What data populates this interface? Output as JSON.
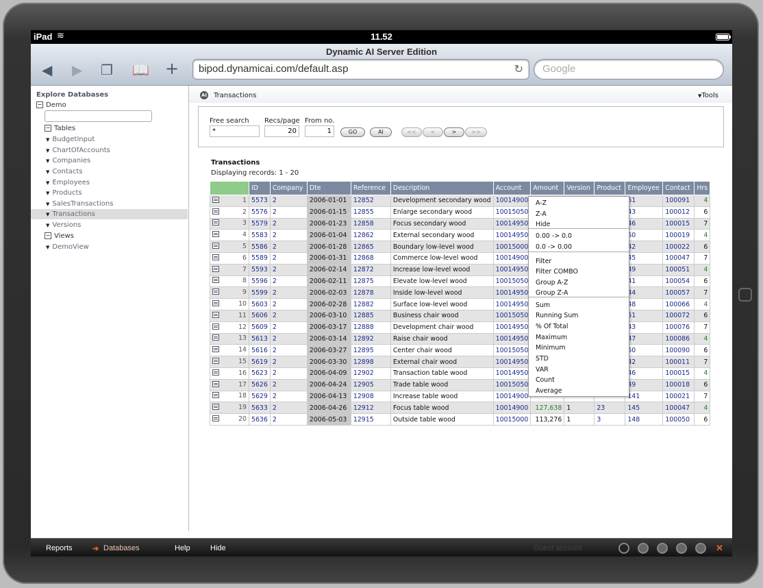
{
  "status": {
    "carrier": "iPad",
    "time": "11.52"
  },
  "browser": {
    "title": "Dynamic AI Server Edition",
    "url": "bipod.dynamicai.com/default.asp",
    "search_placeholder": "Google"
  },
  "sidebar": {
    "header": "Explore Databases",
    "root": "Demo",
    "tables_label": "Tables",
    "tables": [
      "BudgetInput",
      "ChartOfAccounts",
      "Companies",
      "Contacts",
      "Employees",
      "Products",
      "SalesTransactions",
      "Transactions",
      "Versions"
    ],
    "views_label": "Views",
    "views": [
      "DemoView"
    ]
  },
  "main": {
    "title": "Transactions",
    "tools": "Tools",
    "search": {
      "free_label": "Free search",
      "free_value": "*",
      "recs_label": "Recs/page",
      "recs_value": "20",
      "from_label": "From no.",
      "from_value": "1",
      "go": "GO",
      "ai": "AI",
      "first": "<<",
      "prev": "<",
      "next": ">",
      "last": ">>"
    },
    "table_title": "Transactions",
    "displaying": "Displaying records: 1 - 20"
  },
  "grid": {
    "columns": [
      "",
      "ID",
      "Company",
      "Dte",
      "Reference",
      "Description",
      "Account",
      "Amount",
      "Version",
      "Product",
      "Employee",
      "Contact",
      "Hrs"
    ],
    "rows": [
      [
        "1",
        "5573",
        "2",
        "2006-01-01",
        "12852",
        "Development secondary wood",
        "10014900",
        "",
        "",
        "",
        "51",
        "100091",
        "4"
      ],
      [
        "2",
        "5576",
        "2",
        "2006-01-15",
        "12855",
        "Enlarge secondary wood",
        "10015050",
        "",
        "",
        "",
        "43",
        "100012",
        "6"
      ],
      [
        "3",
        "5579",
        "2",
        "2006-01-23",
        "12858",
        "Focus secondary wood",
        "10014950",
        "",
        "",
        "",
        "46",
        "100015",
        "7"
      ],
      [
        "4",
        "5583",
        "2",
        "2006-01-04",
        "12862",
        "External secondary wood",
        "10014950",
        "",
        "",
        "",
        "50",
        "100019",
        "4"
      ],
      [
        "5",
        "5586",
        "2",
        "2006-01-28",
        "12865",
        "Boundary low-level wood",
        "10015000",
        "",
        "",
        "",
        "42",
        "100022",
        "6"
      ],
      [
        "6",
        "5589",
        "2",
        "2006-01-31",
        "12868",
        "Commerce low-level wood",
        "10014900",
        "",
        "",
        "",
        "45",
        "100047",
        "7"
      ],
      [
        "7",
        "5593",
        "2",
        "2006-02-14",
        "12872",
        "Increase low-level wood",
        "10014950",
        "",
        "",
        "",
        "49",
        "100051",
        "4"
      ],
      [
        "8",
        "5596",
        "2",
        "2006-02-11",
        "12875",
        "Elevate low-level wood",
        "10015050",
        "",
        "",
        "",
        "41",
        "100054",
        "6"
      ],
      [
        "9",
        "5599",
        "2",
        "2006-02-03",
        "12878",
        "Inside low-level wood",
        "10014950",
        "",
        "",
        "",
        "44",
        "100057",
        "7"
      ],
      [
        "10",
        "5603",
        "2",
        "2006-02-28",
        "12882",
        "Surface low-level wood",
        "10014950",
        "",
        "",
        "",
        "48",
        "100066",
        "4"
      ],
      [
        "11",
        "5606",
        "2",
        "2006-03-10",
        "12885",
        "Business chair wood",
        "10015050",
        "",
        "",
        "",
        "51",
        "100072",
        "6"
      ],
      [
        "12",
        "5609",
        "2",
        "2006-03-17",
        "12888",
        "Development chair wood",
        "10014950",
        "",
        "",
        "",
        "43",
        "100076",
        "7"
      ],
      [
        "13",
        "5613",
        "2",
        "2006-03-14",
        "12892",
        "Raise chair wood",
        "10014950",
        "",
        "",
        "",
        "47",
        "100086",
        "4"
      ],
      [
        "14",
        "5616",
        "2",
        "2006-03-27",
        "12895",
        "Center chair wood",
        "10015050",
        "",
        "",
        "",
        "50",
        "100090",
        "6"
      ],
      [
        "15",
        "5619",
        "2",
        "2006-03-30",
        "12898",
        "External chair wood",
        "10014950",
        "",
        "",
        "",
        "42",
        "100011",
        "7"
      ],
      [
        "16",
        "5623",
        "2",
        "2006-04-09",
        "12902",
        "Transaction table wood",
        "10014950",
        "",
        "",
        "",
        "46",
        "100015",
        "4"
      ],
      [
        "17",
        "5626",
        "2",
        "2006-04-24",
        "12905",
        "Trade table wood",
        "10015050",
        "",
        "",
        "",
        "49",
        "100018",
        "6"
      ],
      [
        "18",
        "5629",
        "2",
        "2006-04-13",
        "12908",
        "Increase table wood",
        "10014900",
        "",
        "",
        "",
        "141",
        "100021",
        "7"
      ],
      [
        "19",
        "5633",
        "2",
        "2006-04-26",
        "12912",
        "Focus table wood",
        "10014900",
        "127,638",
        "1",
        "23",
        "145",
        "100047",
        "4"
      ],
      [
        "20",
        "5636",
        "2",
        "2006-05-03",
        "12915",
        "Outside table wood",
        "10015000",
        "113,276",
        "1",
        "3",
        "148",
        "100050",
        "6"
      ]
    ]
  },
  "context_menu": {
    "items": [
      "A-Z",
      "Z-A",
      "Hide",
      "0.00 -> 0.0",
      "0.0 -> 0.00",
      "Filter",
      "Filter COMBO",
      "Group A-Z",
      "Group Z-A",
      "Sum",
      "Running Sum",
      "% Of Total",
      "Maximum",
      "Minimum",
      "STD",
      "VAR",
      "Count",
      "Average"
    ]
  },
  "bottombar": {
    "reports": "Reports",
    "arrow": "➔",
    "databases": "Databases",
    "help": "Help",
    "hide": "Hide",
    "guest": "Guest account",
    "close": "✕"
  },
  "colors": {
    "header_bg": "#7b8aa0",
    "accent_green": "#8fcc8a",
    "link": "#1a2a8c",
    "orange": "#e8622a"
  }
}
